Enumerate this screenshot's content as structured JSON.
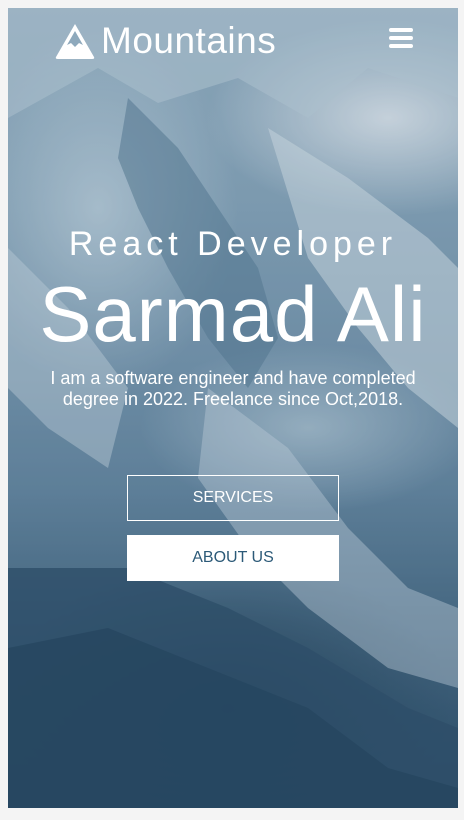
{
  "nav": {
    "brand": "Mountains",
    "logo_icon": "mountain-icon",
    "menu_icon": "hamburger-menu-icon"
  },
  "hero": {
    "subtitle": "React Developer",
    "name": "Sarmad Ali",
    "description": "I am a software engineer and have completed degree in 2022. Freelance since Oct,2018.",
    "buttons": {
      "services": "SERVICES",
      "about": "ABOUT US"
    }
  },
  "colors": {
    "text": "#ffffff",
    "about_text": "#2c5a78",
    "overlay": "#294f6e"
  }
}
